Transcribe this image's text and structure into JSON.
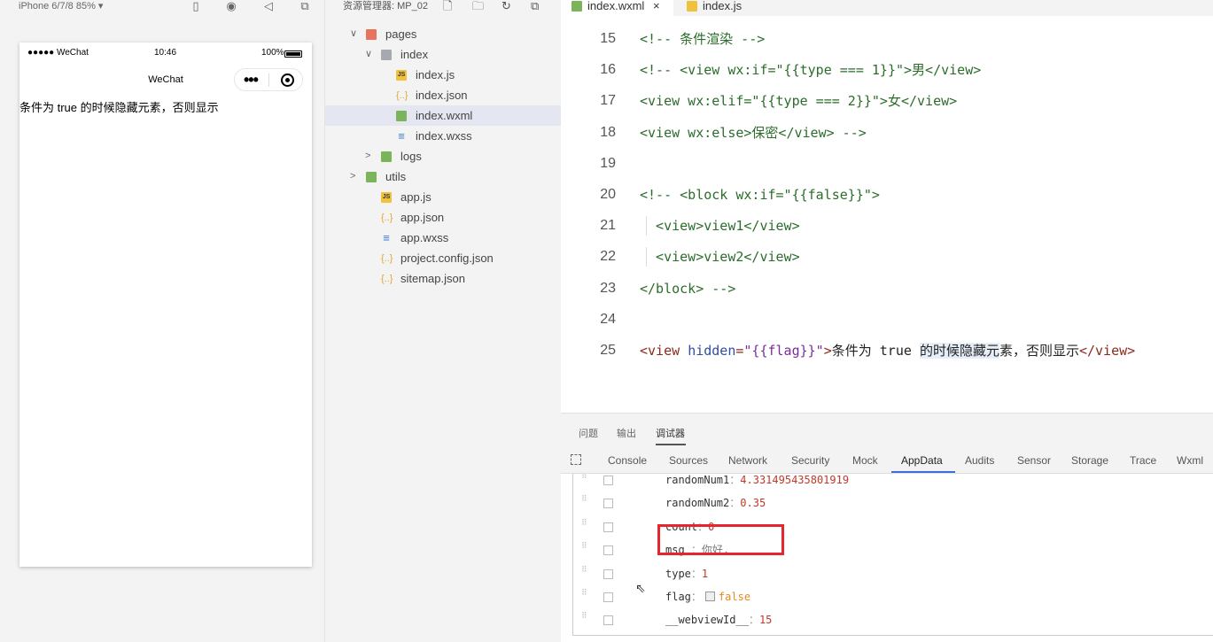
{
  "simulator": {
    "device_label": "iPhone 6/7/8 85% ▾",
    "status": {
      "carrier": "●●●●● WeChat",
      "time": "10:46",
      "battery": "100%"
    },
    "navbar_title": "WeChat",
    "capsule_dots": "•••",
    "page_text": "条件为 true 的时候隐藏元素，否则显示"
  },
  "explorer": {
    "title": "资源管理器: MP_02",
    "tree": [
      {
        "label": "pages",
        "type": "folder-red",
        "chevron": "∨",
        "depth": 0
      },
      {
        "label": "index",
        "type": "folder",
        "chevron": "∨",
        "depth": 1
      },
      {
        "label": "index.js",
        "type": "js",
        "depth": 2
      },
      {
        "label": "index.json",
        "type": "json",
        "depth": 2
      },
      {
        "label": "index.wxml",
        "type": "wxml",
        "depth": 2,
        "selected": true
      },
      {
        "label": "index.wxss",
        "type": "wxss",
        "depth": 2
      },
      {
        "label": "logs",
        "type": "folder-green",
        "chevron": ">",
        "depth": 1
      },
      {
        "label": "utils",
        "type": "folder-green",
        "chevron": ">",
        "depth": 0
      },
      {
        "label": "app.js",
        "type": "js",
        "depth": 1
      },
      {
        "label": "app.json",
        "type": "json",
        "depth": 1
      },
      {
        "label": "app.wxss",
        "type": "wxss",
        "depth": 1
      },
      {
        "label": "project.config.json",
        "type": "json",
        "depth": 1
      },
      {
        "label": "sitemap.json",
        "type": "json",
        "depth": 1
      }
    ]
  },
  "editor": {
    "tabs": [
      {
        "label": "index.wxml",
        "active": true,
        "close": "×"
      },
      {
        "label": "index.js",
        "active": false
      }
    ],
    "lines": [
      {
        "num": "15",
        "text": "<!-- 条件渲染 -->"
      },
      {
        "num": "16",
        "text": "<!-- <view wx:if=\"{{type === 1}}\">男</view>"
      },
      {
        "num": "17",
        "text": "<view wx:elif=\"{{type === 2}}\">女</view>"
      },
      {
        "num": "18",
        "text": "<view wx:else>保密</view> -->"
      },
      {
        "num": "19",
        "text": ""
      },
      {
        "num": "20",
        "text": "<!-- <block wx:if=\"{{false}}\">"
      },
      {
        "num": "21",
        "text": "  <view>view1</view>"
      },
      {
        "num": "22",
        "text": "  <view>view2</view>"
      },
      {
        "num": "23",
        "text": "</block> -->"
      },
      {
        "num": "24",
        "text": ""
      },
      {
        "num": "25",
        "tag_open": "<view ",
        "attr": "hidden",
        "eq": "=",
        "value": "\"{{flag}}\"",
        "close": ">",
        "text_a": "条件为 true ",
        "text_hl": "的时候隐藏元",
        "text_b": "素，否则显示",
        "tag_end": "</view>"
      }
    ]
  },
  "panel": {
    "tabs": [
      "问题",
      "输出",
      "调试器"
    ],
    "devtools_tabs": [
      "Console",
      "Sources",
      "Network",
      "Security",
      "Mock",
      "AppData",
      "Audits",
      "Sensor",
      "Storage",
      "Trace",
      "Wxml"
    ],
    "appdata": [
      {
        "key": "randomNum1",
        "sep": "：",
        "value": "4.331495435801919",
        "kind": "num"
      },
      {
        "key": "randomNum2",
        "sep": "：",
        "value": "0.35",
        "kind": "num"
      },
      {
        "key": "count",
        "sep": "：",
        "value": "0",
        "kind": "num"
      },
      {
        "key": "msg",
        "sep": " ：",
        "value": "你好,",
        "kind": "str"
      },
      {
        "key": "type",
        "sep": "：",
        "value": "1",
        "kind": "num"
      },
      {
        "key": "flag",
        "sep": "：",
        "value": "false",
        "kind": "bool"
      },
      {
        "key": "__webviewId__",
        "sep": "：",
        "value": "15",
        "kind": "num"
      }
    ]
  },
  "colors": {
    "highlight_box": "#e8252f",
    "accent_tab": "#3c6fd8"
  }
}
